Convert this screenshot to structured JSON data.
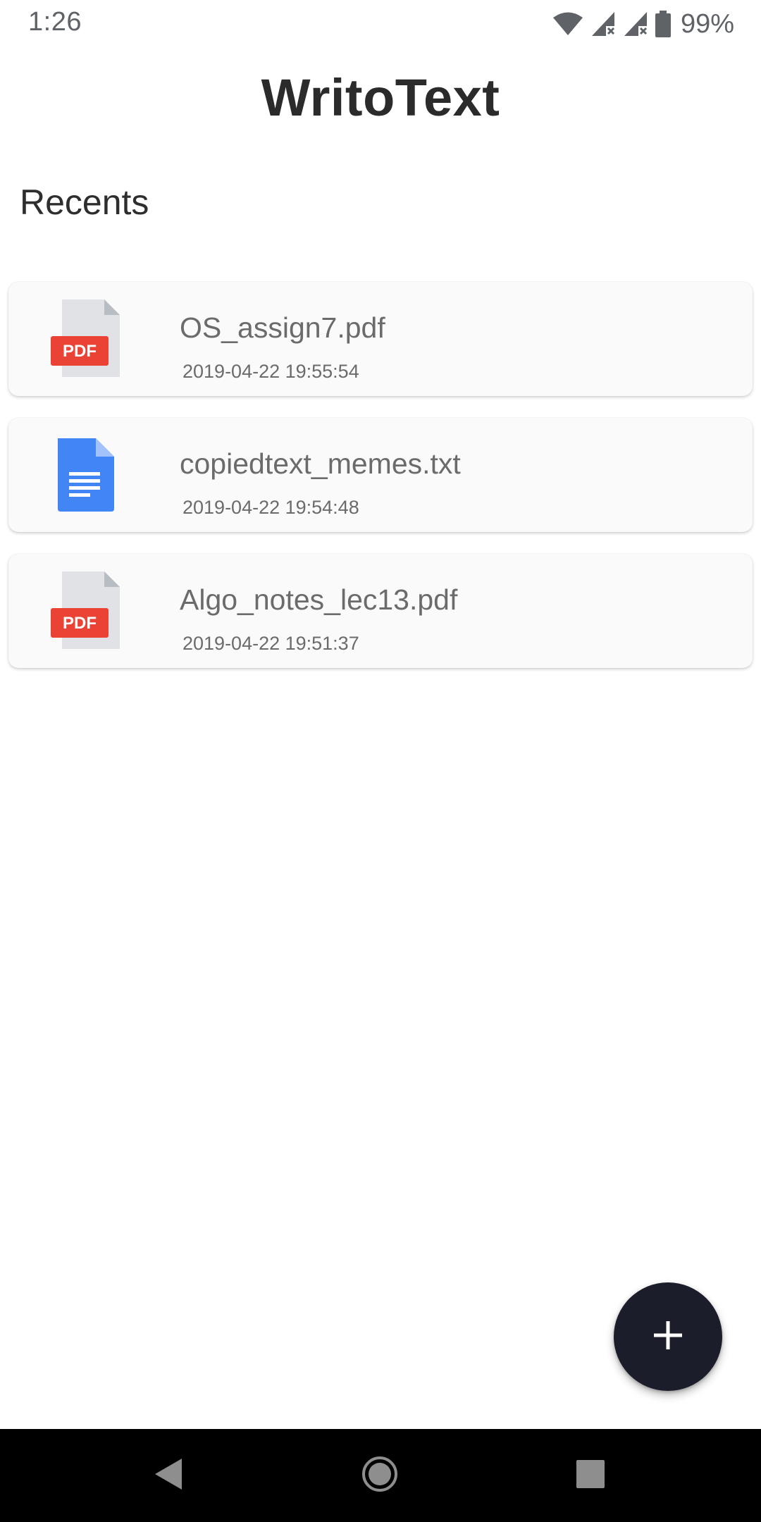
{
  "status_bar": {
    "time": "1:26",
    "battery": "99%",
    "icons": [
      "wifi-icon",
      "signal-no-service-icon",
      "signal-no-service-icon",
      "battery-icon"
    ]
  },
  "app": {
    "title": "WritoText"
  },
  "recents": {
    "title": "Recents",
    "files": [
      {
        "name": "OS_assign7.pdf",
        "date": "2019-04-22 19:55:54",
        "type": "pdf",
        "icon_label": "PDF"
      },
      {
        "name": "copiedtext_memes.txt",
        "date": "2019-04-22 19:54:48",
        "type": "txt",
        "icon_label": ""
      },
      {
        "name": "Algo_notes_lec13.pdf",
        "date": "2019-04-22 19:51:37",
        "type": "pdf",
        "icon_label": "PDF"
      }
    ]
  },
  "fab": {
    "icon": "plus-icon"
  },
  "nav_bar": {
    "icons": [
      "back-icon",
      "home-icon",
      "recents-icon"
    ]
  },
  "colors": {
    "pdf_red": "#ea4335",
    "doc_blue": "#4285f4",
    "fab_bg": "#1c1d2b"
  }
}
